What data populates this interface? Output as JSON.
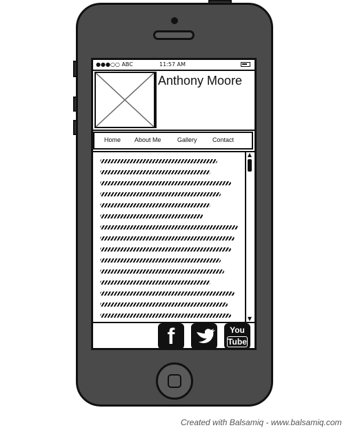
{
  "status_bar": {
    "carrier": "●●●○○ ABC",
    "time": "11:57 AM",
    "battery_icon": "battery-icon"
  },
  "profile": {
    "name": "Anthony Moore",
    "image_icon": "image-placeholder-icon"
  },
  "nav": {
    "items": [
      {
        "label": "Home"
      },
      {
        "label": "About Me"
      },
      {
        "label": "Gallery"
      },
      {
        "label": "Contact"
      }
    ]
  },
  "content": {
    "text_placeholder": "scribbled-text"
  },
  "social": {
    "facebook_label": "f",
    "twitter_icon": "twitter-bird-icon",
    "youtube_top": "You",
    "youtube_bottom": "Tube"
  },
  "credit": "Created with Balsamiq - www.balsamiq.com"
}
